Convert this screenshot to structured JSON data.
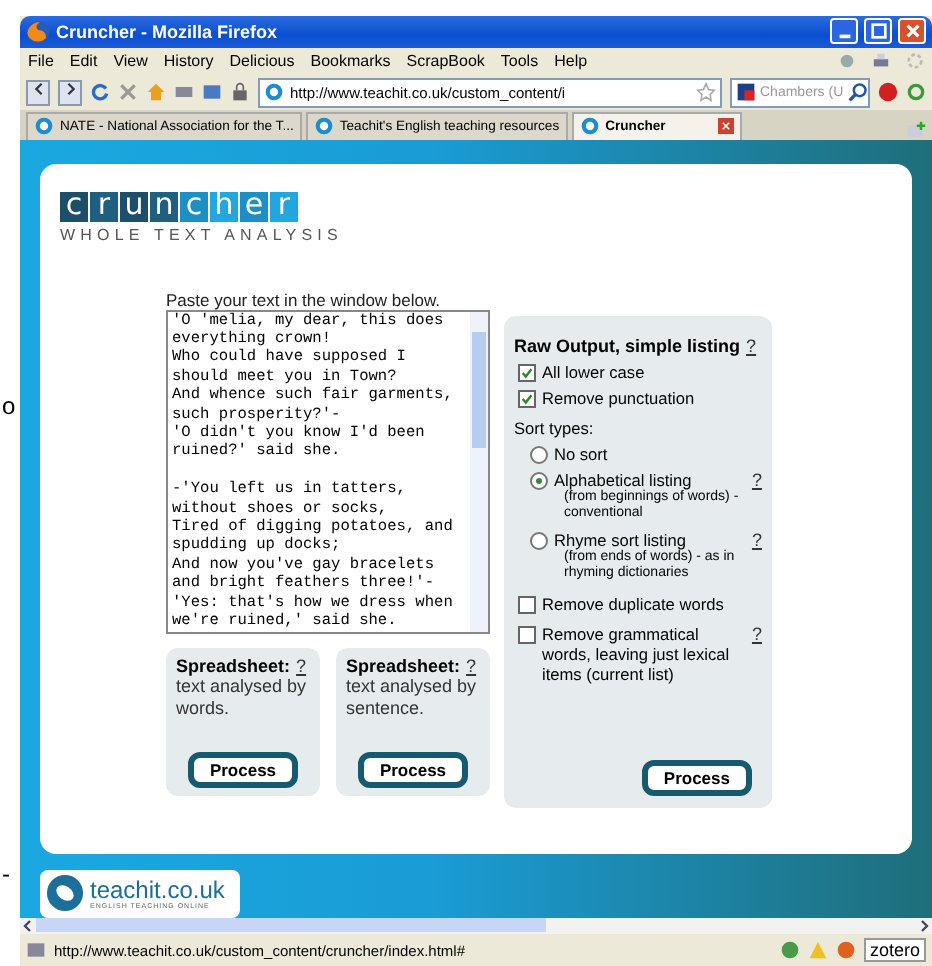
{
  "page_edge_fragments": [
    "o",
    "-"
  ],
  "window": {
    "title": "Cruncher - Mozilla Firefox"
  },
  "menu": [
    "File",
    "Edit",
    "View",
    "History",
    "Delicious",
    "Bookmarks",
    "ScrapBook",
    "Tools",
    "Help"
  ],
  "toolbar": {
    "url": "http://www.teachit.co.uk/custom_content/i",
    "search_placeholder": "Chambers (U"
  },
  "tabs": [
    {
      "label": "NATE - National Association for the T...",
      "selected": false
    },
    {
      "label": "Teachit's English teaching resources",
      "selected": false
    },
    {
      "label": "Cruncher",
      "selected": true
    }
  ],
  "logo": {
    "letters": [
      {
        "char": "c",
        "color": "#1d4f6b"
      },
      {
        "char": "r",
        "color": "#1f5f80"
      },
      {
        "char": "u",
        "color": "#1d4f6b"
      },
      {
        "char": "n",
        "color": "#1f5f80"
      },
      {
        "char": "c",
        "color": "#1c8fc4"
      },
      {
        "char": "h",
        "color": "#23a6de"
      },
      {
        "char": "e",
        "color": "#1c8fc4"
      },
      {
        "char": "r",
        "color": "#23a6de"
      }
    ],
    "tagline": "WHOLE TEXT ANALYSIS"
  },
  "instruction": "Paste your text in the window below.",
  "text_input": {
    "value": "'O 'melia, my dear, this does\neverything crown!\nWho could have supposed I\nshould meet you in Town?\nAnd whence such fair garments,\nsuch prosperity?'-\n'O didn't you know I'd been\nruined?' said she.\n\n-'You left us in tatters,\nwithout shoes or socks,\nTired of digging potatoes, and\nspudding up docks;\nAnd now you've gay bracelets\nand bright feathers three!'-\n'Yes: that's how we dress when\nwe're ruined,' said she."
  },
  "spreadsheets": [
    {
      "title": "Spreadsheet:",
      "help": "?",
      "description": "text analysed by words.",
      "button": "Process"
    },
    {
      "title": "Spreadsheet:",
      "help": "?",
      "description": "text analysed by sentence.",
      "button": "Process"
    }
  ],
  "raw_output": {
    "title": "Raw Output, simple listing",
    "help": "?",
    "options": [
      {
        "label": "All lower case",
        "checked": true
      },
      {
        "label": "Remove punctuation",
        "checked": true
      }
    ],
    "sort_label": "Sort types:",
    "sorts": [
      {
        "label": "No sort",
        "selected": false
      },
      {
        "label": "Alphabetical listing",
        "note": "(from beginnings of words) - conventional",
        "help": "?",
        "selected": true
      },
      {
        "label": "Rhyme sort listing",
        "note": "(from ends of words) - as in rhyming dictionaries",
        "help": "?",
        "selected": false
      }
    ],
    "filters": [
      {
        "label": "Remove duplicate words",
        "checked": false
      },
      {
        "label": "Remove grammatical words, leaving just lexical items (current list)",
        "help": "?",
        "checked": false
      }
    ],
    "button": "Process"
  },
  "footer_logo": {
    "name": "teachit.co.uk",
    "tagline": "ENGLISH TEACHING ONLINE"
  },
  "status_bar": {
    "url": "http://www.teachit.co.uk/custom_content/cruncher/index.html#",
    "addon": "zotero"
  }
}
